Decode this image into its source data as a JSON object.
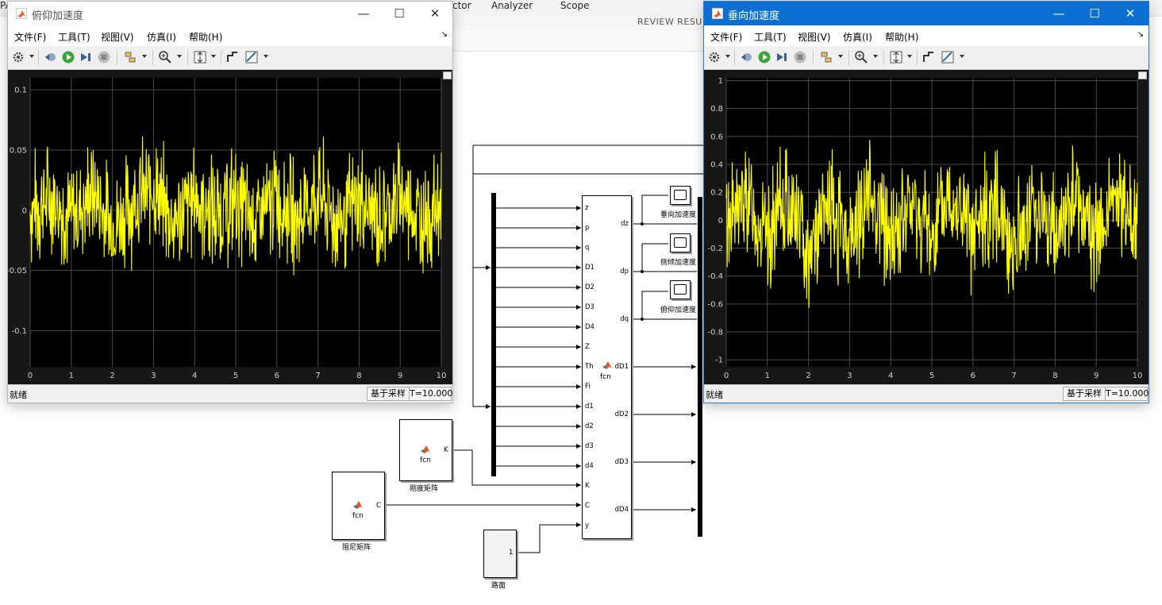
{
  "background": {
    "tabs": [
      "ctor",
      "Analyzer",
      "Scope"
    ],
    "review_label": "REVIEW RESUL",
    "left_cutoff": "PA"
  },
  "scope_left": {
    "title": "俯仰加速度",
    "menu": [
      "文件(F)",
      "工具(T)",
      "视图(V)",
      "仿真(I)",
      "帮助(H)"
    ],
    "y_ticks": [
      "0.1",
      "0.05",
      "0",
      "-0.05",
      "-0.1"
    ],
    "x_ticks": [
      "0",
      "1",
      "2",
      "3",
      "4",
      "5",
      "6",
      "7",
      "8",
      "9",
      "10"
    ],
    "status": "就绪",
    "sample_mode": "基于采样",
    "time": "T=10.000"
  },
  "scope_right": {
    "title": "垂向加速度",
    "menu": [
      "文件(F)",
      "工具(T)",
      "视图(V)",
      "仿真(I)",
      "帮助(H)"
    ],
    "y_ticks": [
      "1",
      "0.8",
      "0.6",
      "0.4",
      "0.2",
      "0",
      "-0.2",
      "-0.4",
      "-0.6",
      "-0.8",
      "-1"
    ],
    "x_ticks": [
      "0",
      "1",
      "2",
      "3",
      "4",
      "5",
      "6",
      "7",
      "8",
      "9",
      "10"
    ],
    "status": "就绪",
    "sample_mode": "基于采样",
    "time": "T=10.000"
  },
  "chart_data": [
    {
      "type": "line",
      "series_color": "#ffff00",
      "background": "#000000",
      "xlim": [
        0,
        10
      ],
      "ylim": [
        -0.13,
        0.11
      ],
      "grid": true,
      "x": [
        0,
        0.5,
        1,
        1.5,
        2,
        2.5,
        3,
        3.5,
        4,
        4.5,
        5,
        5.5,
        6,
        6.5,
        7,
        7.5,
        8,
        8.5,
        9,
        9.5,
        10
      ],
      "y": [
        0.0,
        0.03,
        -0.02,
        0.04,
        -0.04,
        0.02,
        0.05,
        -0.03,
        0.03,
        -0.01,
        0.02,
        -0.03,
        0.03,
        -0.02,
        0.04,
        -0.03,
        0.02,
        -0.02,
        0.03,
        -0.02,
        0.01
      ]
    },
    {
      "type": "line",
      "series_color": "#ffff00",
      "background": "#000000",
      "xlim": [
        0,
        10
      ],
      "ylim": [
        -1.05,
        1.02
      ],
      "grid": true,
      "x": [
        0,
        0.5,
        1,
        1.5,
        2,
        2.5,
        3,
        3.5,
        4,
        4.5,
        5,
        5.5,
        6,
        6.5,
        7,
        7.5,
        8,
        8.5,
        9,
        9.5,
        10
      ],
      "y": [
        0.0,
        0.4,
        -0.4,
        0.5,
        -0.6,
        0.3,
        -0.5,
        0.6,
        -0.4,
        0.3,
        -0.3,
        0.5,
        -0.4,
        0.4,
        -0.5,
        0.3,
        -0.3,
        0.4,
        -0.3,
        0.3,
        0.0
      ]
    }
  ],
  "diagram": {
    "fcn_main": {
      "label": "fcn",
      "inputs": [
        "z",
        "p",
        "q",
        "D1",
        "D2",
        "D3",
        "D4",
        "Z",
        "Th",
        "Fi",
        "d1",
        "d2",
        "d3",
        "d4",
        "K",
        "C",
        "y"
      ],
      "outputs": [
        "dz",
        "dp",
        "dq",
        "dD1",
        "dD2",
        "dD3",
        "dD4"
      ]
    },
    "fcn_k": {
      "label": "fcn",
      "port": "K",
      "caption": "刚度矩阵"
    },
    "fcn_c": {
      "label": "fcn",
      "port": "C",
      "caption": "阻尼矩阵"
    },
    "road": {
      "port": "1",
      "caption": "路面"
    },
    "scope_captions": [
      "垂向加速度",
      "侧倾加速度",
      "俯仰加速度"
    ]
  }
}
